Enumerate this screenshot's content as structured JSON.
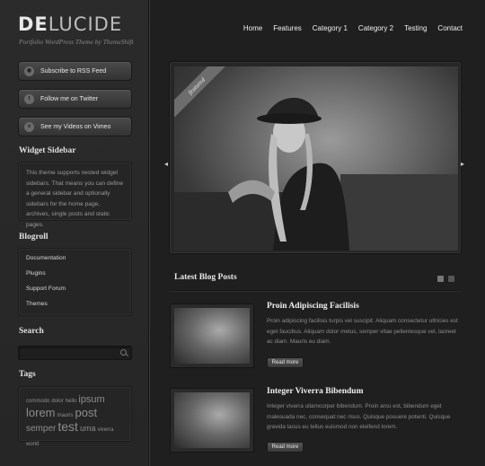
{
  "brand": {
    "logo_bold": "DE",
    "logo_light": "LUCIDE",
    "tagline": "Portfolio WordPress Theme by ThemeShift"
  },
  "nav": {
    "items": [
      "Home",
      "Features",
      "Category 1",
      "Category 2",
      "Testing",
      "Contact"
    ]
  },
  "social": {
    "rss": {
      "label": "Subscribe to RSS Feed",
      "icon": "rss-icon",
      "glyph": "◉"
    },
    "twitter": {
      "label": "Follow me on Twitter",
      "icon": "twitter-icon",
      "glyph": "t"
    },
    "vimeo": {
      "label": "See my Videos on Vimeo",
      "icon": "vimeo-icon",
      "glyph": "v"
    }
  },
  "widget": {
    "title": "Widget Sidebar",
    "text": "This theme supports nested widget sidebars. That means you can define a general sidebar and optionally sidebars for the home page, archives, single posts and static pages."
  },
  "blogroll": {
    "title": "Blogroll",
    "items": [
      "Documentation",
      "Plugins",
      "Support Forum",
      "Themes"
    ]
  },
  "search": {
    "title": "Search",
    "placeholder": ""
  },
  "tags": {
    "title": "Tags",
    "items": [
      "commodo",
      "dolor",
      "hello",
      "ipsum",
      "lorem",
      "mauris",
      "post",
      "semper",
      "test",
      "uma",
      "viverra",
      "world"
    ]
  },
  "slider": {
    "ribbon": "featured",
    "prev": "◂",
    "next": "▸"
  },
  "latest": {
    "title": "Latest Blog Posts",
    "posts": [
      {
        "title": "Proin Adipiscing Facilisis",
        "excerpt": "Proin adipiscing facilisis turpis vel suscipit. Aliquam consectetur ultricies est eget faucibus. Aliquam dolor metus, semper vitae pellentesque vel, laoreet ac diam. Mauris eu diam.",
        "button": "Read more"
      },
      {
        "title": "Integer Viverra Bibendum",
        "excerpt": "Integer viverra ullamcorper bibendum. Proin arcu est, bibendum eget malesuada nec, consequat nec risus. Quisque posuere potenti. Quisque gravida lacus eu tellus euismod non eleifend lorem.",
        "button": "Read more"
      }
    ]
  }
}
